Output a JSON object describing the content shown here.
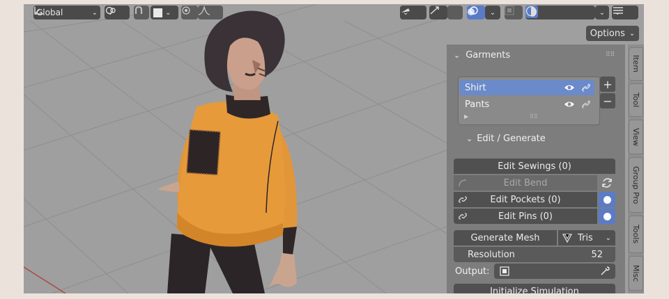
{
  "toolbar": {
    "orientation": "Global",
    "orientation_icon": "transform-orientation-icon",
    "pivot_icon": "pivot-icon",
    "snap_icon": "snap-magnet-icon",
    "proportional_icon": "proportional-edit-icon",
    "falloff_icon": "falloff-curve-icon",
    "visibility_icon": "selectability-icon",
    "gizmo_icon": "gizmo-icon",
    "overlay_icon": "overlay-icon",
    "xray_icon": "xray-icon",
    "shading_modes": [
      "wireframe-icon",
      "solid-icon",
      "material-preview-icon",
      "rendered-icon"
    ],
    "options_label": "Options"
  },
  "panel": {
    "title": "Garments",
    "garments": [
      {
        "name": "Shirt",
        "selected": true
      },
      {
        "name": "Pants",
        "selected": false
      }
    ],
    "add_label": "+",
    "remove_label": "−",
    "subpanel": "Edit / Generate",
    "edit_sewings": "Edit Sewings (0)",
    "edit_bend": "Edit Bend",
    "edit_pockets": "Edit Pockets (0)",
    "edit_pins": "Edit Pins (0)",
    "generate_mesh": "Generate Mesh",
    "mesh_type": "Tris",
    "resolution_label": "Resolution",
    "resolution_value": "52",
    "output_label": "Output:",
    "initialize": "Initialize Simulation"
  },
  "tabs": [
    "Item",
    "Tool",
    "View",
    "Group Pro",
    "Tools",
    "Misc"
  ],
  "colors": {
    "selected_row": "#6a8ac9",
    "button": "#505050",
    "shirt": "#e69a3a",
    "hair": "#3a3236"
  }
}
